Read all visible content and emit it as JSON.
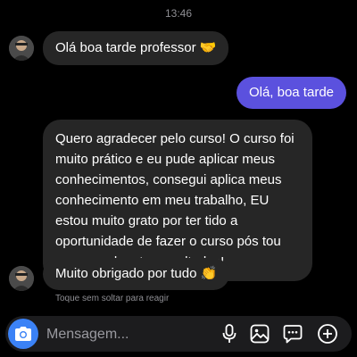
{
  "header": {
    "time": "13:46"
  },
  "messages": [
    {
      "direction": "in",
      "text": "Olá boa tarde professor",
      "emoji": "🤝"
    },
    {
      "direction": "out",
      "text": "Olá, boa tarde"
    },
    {
      "direction": "in",
      "text": "Quero agradecer pelo curso! O curso foi muito prático e eu pude aplicar meus conhecimentos, consegui aplica meus conhecimento em meu trabalho, EU estou muito grato por ter tido a oportunidade de fazer o curso pós tou começando a ter resultados!"
    },
    {
      "direction": "in",
      "text": "Muito obrigado por tudo",
      "emoji": "👏"
    }
  ],
  "hint": "Toque sem soltar para reagir",
  "composer": {
    "placeholder": "Mensagem...",
    "icons": [
      "camera-icon",
      "microphone-icon",
      "gallery-icon",
      "sticker-icon",
      "add-icon"
    ]
  },
  "colors": {
    "background": "#000000",
    "incoming_bubble": "#262626",
    "outgoing_bubble": "#5b51de",
    "camera_button": "#3b82f6"
  }
}
